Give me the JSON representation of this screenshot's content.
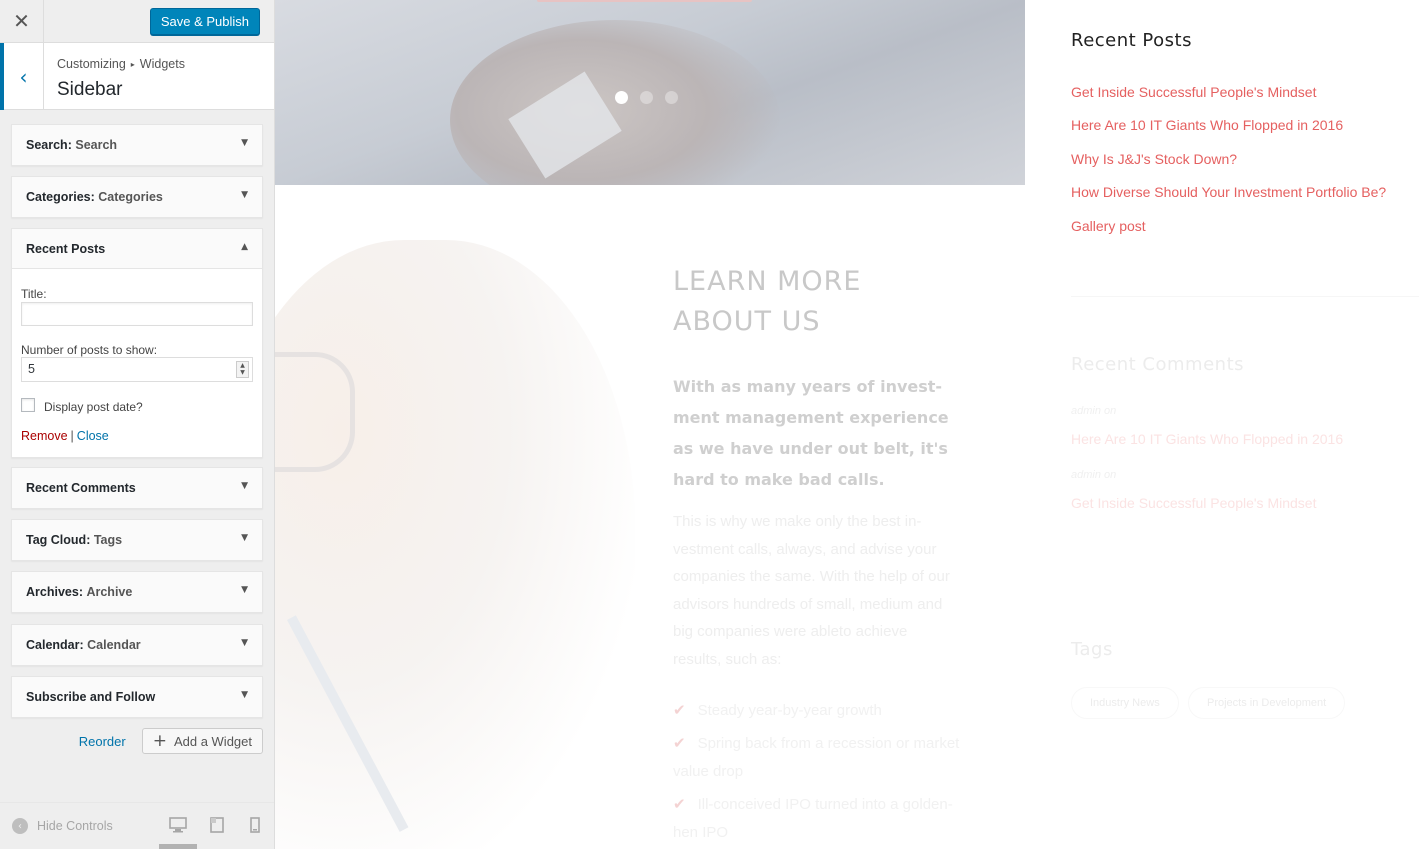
{
  "customizer": {
    "close_icon": "✕",
    "save_button": "Save & Publish",
    "breadcrumb_parent": "Customizing",
    "breadcrumb_child": "Widgets",
    "section_title": "Sidebar",
    "widgets": [
      {
        "name": "Search",
        "subtitle": "Search",
        "separator": ":"
      },
      {
        "name": "Categories",
        "subtitle": "Categories",
        "separator": ":"
      },
      {
        "name": "Recent Posts",
        "subtitle": "",
        "separator": ""
      },
      {
        "name": "Recent Comments",
        "subtitle": "",
        "separator": ""
      },
      {
        "name": "Tag Cloud",
        "subtitle": "Tags",
        "separator": ":"
      },
      {
        "name": "Archives",
        "subtitle": "Archive",
        "separator": ":"
      },
      {
        "name": "Calendar",
        "subtitle": "Calendar",
        "separator": ":"
      },
      {
        "name": "Subscribe and Follow",
        "subtitle": "",
        "separator": ""
      }
    ],
    "recent_posts_form": {
      "title_label": "Title:",
      "title_value": "",
      "number_label": "Number of posts to show:",
      "number_value": "5",
      "display_date_label": "Display post date?",
      "display_date_checked": false,
      "remove_label": "Remove",
      "separator": "|",
      "close_label": "Close"
    },
    "reorder_label": "Reorder",
    "add_widget_label": "Add a Widget",
    "hide_controls_label": "Hide Controls",
    "accent_color": "#0073aa",
    "save_color": "#0085ba"
  },
  "preview": {
    "learn_heading_line1": "LEARN MORE",
    "learn_heading_line2": "ABOUT US",
    "learn_lead": "With as many years of invest-ment management experience as we have under out belt, it's hard to make bad calls.",
    "learn_body": "This is why we make only the best in-vestment calls, always, and advise your companies the same.  With the help of our advisors hundreds of small, medium and big companies were ableto achieve results, such as:",
    "learn_list": [
      "Steady year-by-year growth",
      "Spring back from a recession or market value drop",
      "Ill-conceived IPO turned into a golden-hen IPO"
    ],
    "recent_posts_heading": "Recent Posts",
    "recent_posts": [
      "Get Inside Successful People's Mindset",
      "Here Are 10 IT Giants Who Flopped in 2016",
      "Why Is J&J's Stock Down?",
      "How Diverse Should Your Investment Portfolio Be?",
      "Gallery post"
    ],
    "recent_comments_heading": "Recent Comments",
    "recent_comments": [
      {
        "meta": "admin  on",
        "link": "Here Are 10 IT Giants Who Flopped in 2016"
      },
      {
        "meta": "admin  on",
        "link": "Get Inside Successful People's Mindset"
      }
    ],
    "tags_heading": "Tags",
    "tags": [
      "Industry News",
      "Projects in Development"
    ],
    "link_color": "#e56060"
  }
}
